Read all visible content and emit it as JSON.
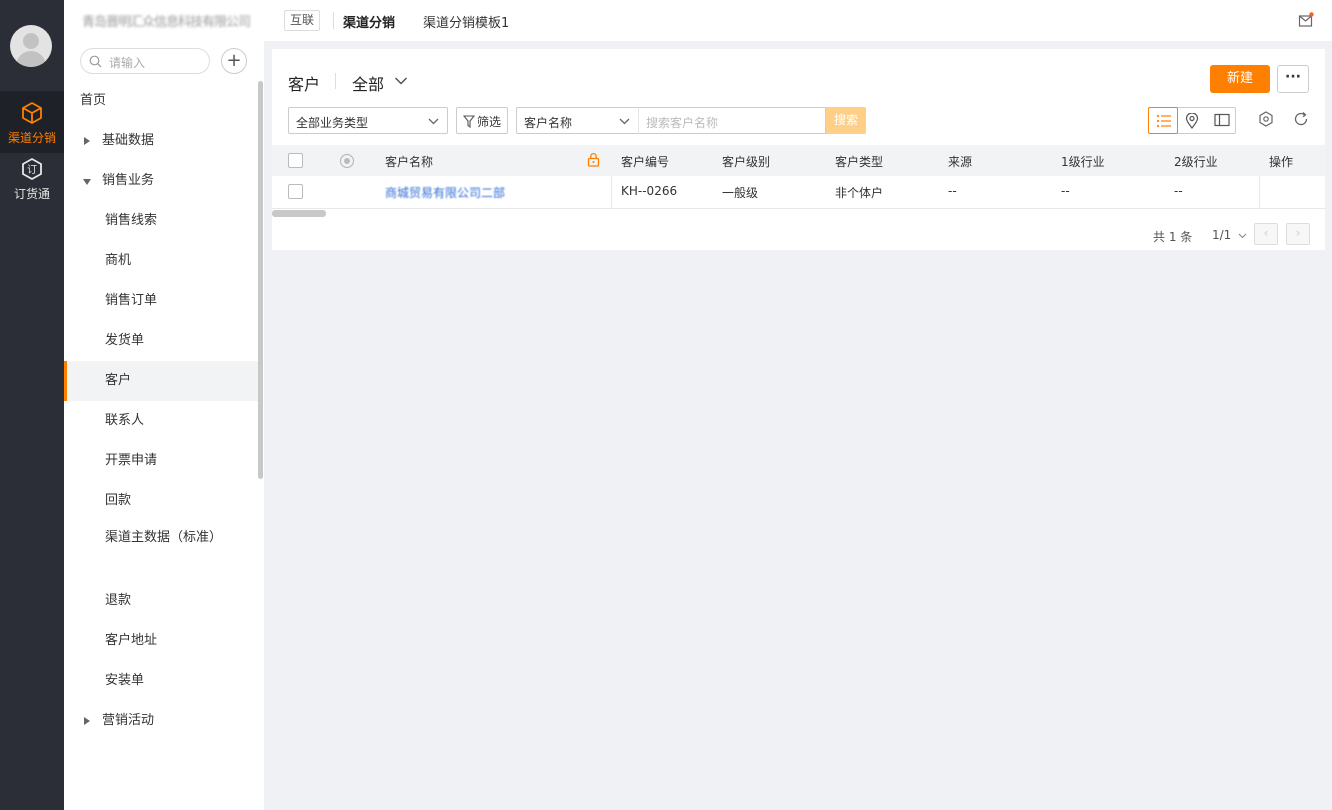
{
  "topbar": {
    "company_name": "青岛晋明汇众信息科技有限公司",
    "tag": "互联",
    "crumb_active": "渠道分销",
    "crumb_template": "渠道分销模板1"
  },
  "rail": {
    "items": [
      {
        "label": "渠道分销",
        "icon": "cube-icon",
        "active": true
      },
      {
        "label": "订货通",
        "icon": "order-icon",
        "active": false
      }
    ]
  },
  "sidebar": {
    "search_placeholder": "请输入",
    "add_label": "+",
    "items": [
      {
        "label": "首页",
        "kind": "top"
      },
      {
        "label": "基础数据",
        "kind": "group-collapsed"
      },
      {
        "label": "销售业务",
        "kind": "group-expanded"
      },
      {
        "label": "销售线索",
        "kind": "child"
      },
      {
        "label": "商机",
        "kind": "child"
      },
      {
        "label": "销售订单",
        "kind": "child"
      },
      {
        "label": "发货单",
        "kind": "child"
      },
      {
        "label": "客户",
        "kind": "child-active"
      },
      {
        "label": "联系人",
        "kind": "child"
      },
      {
        "label": "开票申请",
        "kind": "child"
      },
      {
        "label": "回款",
        "kind": "child"
      },
      {
        "label": "渠道主数据（标准）",
        "kind": "child"
      },
      {
        "label": "退款",
        "kind": "child"
      },
      {
        "label": "客户地址",
        "kind": "child"
      },
      {
        "label": "安装单",
        "kind": "child"
      },
      {
        "label": "营销活动",
        "kind": "group-collapsed"
      }
    ]
  },
  "main": {
    "title": "客户",
    "view_label": "全部",
    "new_button": "新建",
    "more_button": "···",
    "business_type_select": "全部业务类型",
    "filter_button": "筛选",
    "search_field_select": "客户名称",
    "search_placeholder": "搜索客户名称",
    "search_button": "搜索",
    "accent_color": "#ff7f00",
    "table": {
      "columns": [
        "客户名称",
        "客户编号",
        "客户级别",
        "客户类型",
        "来源",
        "1级行业",
        "2级行业",
        "操作"
      ],
      "rows": [
        {
          "name": "商城贸易有限公司二部",
          "code": "KH--0266",
          "level": "一般级",
          "type": "非个体户",
          "source": "--",
          "industry1": "--",
          "industry2": "--",
          "action": ""
        }
      ]
    },
    "footer": {
      "total": "共 1 条",
      "page": "1/1"
    }
  }
}
